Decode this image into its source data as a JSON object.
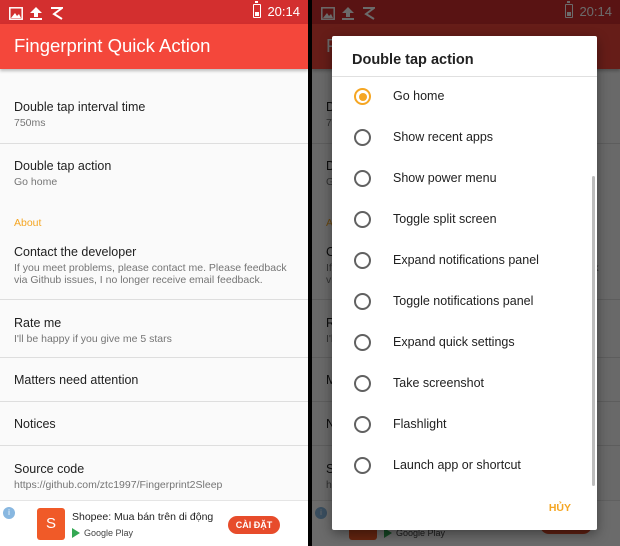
{
  "status_bar": {
    "time": "20:14"
  },
  "app_bar": {
    "title": "Fingerprint Quick Action"
  },
  "settings": {
    "double_tap_interval": {
      "title": "Double tap interval time",
      "summary": "750ms"
    },
    "double_tap_action": {
      "title": "Double tap action",
      "summary": "Go home"
    },
    "about_header": "About",
    "contact": {
      "title": "Contact the developer",
      "summary": "If you meet problems, please contact me. Please feedback via Github issues, I no longer receive email feedback."
    },
    "rate": {
      "title": "Rate me",
      "summary": "I'll be happy if you give me 5 stars"
    },
    "matters": {
      "title": "Matters need attention"
    },
    "notices": {
      "title": "Notices"
    },
    "source": {
      "title": "Source code",
      "summary": "https://github.com/ztc1997/Fingerprint2Sleep"
    }
  },
  "ad": {
    "app_name": "Shopee: Mua bán trên di động",
    "store": "Google Play",
    "install_label": "CÀI ĐẶT"
  },
  "dialog": {
    "title": "Double tap action",
    "options": [
      {
        "label": "Go home",
        "selected": true
      },
      {
        "label": "Show recent apps",
        "selected": false
      },
      {
        "label": "Show power menu",
        "selected": false
      },
      {
        "label": "Toggle split screen",
        "selected": false
      },
      {
        "label": "Expand notifications panel",
        "selected": false
      },
      {
        "label": "Toggle notifications panel",
        "selected": false
      },
      {
        "label": "Expand quick settings",
        "selected": false
      },
      {
        "label": "Take screenshot",
        "selected": false
      },
      {
        "label": "Flashlight",
        "selected": false
      },
      {
        "label": "Launch app or shortcut",
        "selected": false
      }
    ],
    "cancel_label": "HỦY"
  },
  "colors": {
    "status_bar": "#d32f2f",
    "app_bar": "#f4473b",
    "accent": "#f5a623",
    "ad_button": "#e74c2b"
  },
  "icons": [
    "upload-icon",
    "image-icon",
    "notification-icon",
    "battery-icon",
    "radio-button-icon",
    "info-icon",
    "play-store-icon"
  ]
}
